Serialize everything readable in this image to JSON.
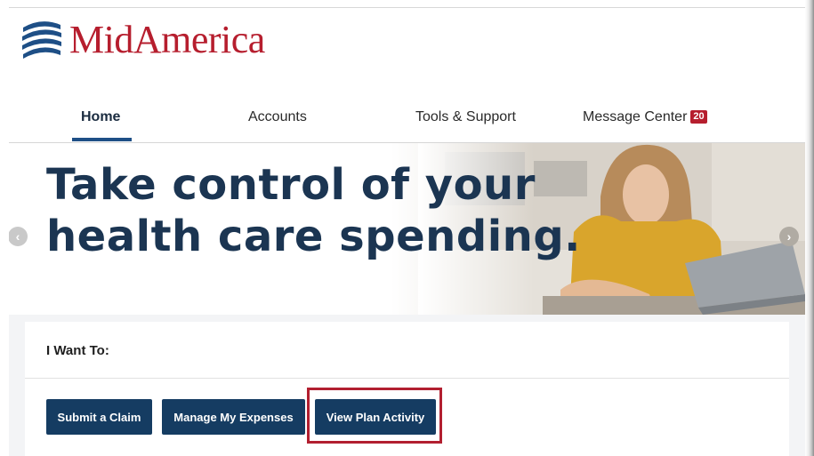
{
  "brand": {
    "name": "MidAmerica",
    "logo_color": "#b61e2e",
    "mark_color": "#1e4f86"
  },
  "nav": {
    "items": [
      {
        "label": "Home",
        "active": true
      },
      {
        "label": "Accounts",
        "active": false
      },
      {
        "label": "Tools & Support",
        "active": false
      },
      {
        "label": "Message Center",
        "active": false,
        "badge": "20"
      }
    ]
  },
  "hero": {
    "heading_line1": "Take control of your",
    "heading_line2": "health care spending.",
    "prev_icon": "chevron-left-icon",
    "next_icon": "chevron-right-icon"
  },
  "actions": {
    "title": "I Want To:",
    "buttons": [
      {
        "label": "Submit a Claim"
      },
      {
        "label": "Manage My Expenses"
      },
      {
        "label": "View Plan Activity",
        "highlighted": true
      }
    ]
  },
  "colors": {
    "primary_button": "#153c62",
    "heading": "#1b3552",
    "highlight": "#b21f30"
  }
}
